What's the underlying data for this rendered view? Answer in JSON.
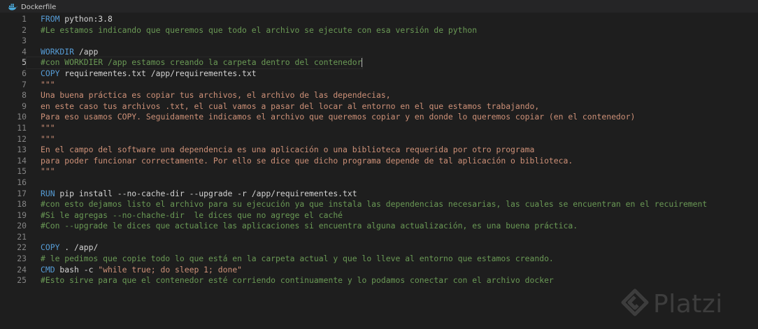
{
  "tab": {
    "filename": "Dockerfile",
    "icon": "docker-icon"
  },
  "colors": {
    "keyword": "#569cd6",
    "comment": "#6a9955",
    "string": "#ce9178",
    "text": "#d4d4d4",
    "line_number": "#858585"
  },
  "editor": {
    "cursor_line": 5,
    "lines": [
      {
        "n": "1",
        "tokens": [
          {
            "t": "kw",
            "v": "FROM"
          },
          {
            "t": "tx",
            "v": " python:3.8"
          }
        ]
      },
      {
        "n": "2",
        "tokens": [
          {
            "t": "cm",
            "v": "#Le estamos indicando que queremos que todo el archivo se ejecute con esa versión de python"
          }
        ]
      },
      {
        "n": "3",
        "tokens": []
      },
      {
        "n": "4",
        "tokens": [
          {
            "t": "kw",
            "v": "WORKDIR"
          },
          {
            "t": "tx",
            "v": " /app"
          }
        ]
      },
      {
        "n": "5",
        "tokens": [
          {
            "t": "cm",
            "v": "#con WORKDIER /app estamos creando la carpeta dentro del contenedor"
          }
        ]
      },
      {
        "n": "6",
        "tokens": [
          {
            "t": "kw",
            "v": "COPY"
          },
          {
            "t": "tx",
            "v": " requirementes.txt /app/requirementes.txt"
          }
        ]
      },
      {
        "n": "7",
        "tokens": [
          {
            "t": "st",
            "v": "\"\"\""
          }
        ]
      },
      {
        "n": "8",
        "tokens": [
          {
            "t": "st",
            "v": "Una buena práctica es copiar tus archivos, el archivo de las dependecias,"
          }
        ]
      },
      {
        "n": "9",
        "tokens": [
          {
            "t": "st",
            "v": "en este caso tus archivos .txt, el cual vamos a pasar del locar al entorno en el que estamos trabajando,"
          }
        ]
      },
      {
        "n": "10",
        "tokens": [
          {
            "t": "st",
            "v": "Para eso usamos COPY. Seguidamente indicamos el archivo que queremos copiar y en donde lo queremos copiar (en el contenedor)"
          }
        ]
      },
      {
        "n": "11",
        "tokens": [
          {
            "t": "st",
            "v": "\"\"\""
          }
        ]
      },
      {
        "n": "12",
        "tokens": [
          {
            "t": "st",
            "v": "\"\"\""
          }
        ]
      },
      {
        "n": "13",
        "tokens": [
          {
            "t": "st",
            "v": "En el campo del software una dependencia es una aplicación o una biblioteca requerida por otro programa"
          }
        ]
      },
      {
        "n": "14",
        "tokens": [
          {
            "t": "st",
            "v": "para poder funcionar correctamente. Por ello se dice que dicho programa depende de tal aplicación o biblioteca."
          }
        ]
      },
      {
        "n": "15",
        "tokens": [
          {
            "t": "st",
            "v": "\"\"\""
          }
        ]
      },
      {
        "n": "16",
        "tokens": []
      },
      {
        "n": "17",
        "tokens": [
          {
            "t": "kw",
            "v": "RUN"
          },
          {
            "t": "tx",
            "v": " pip install --no-cache-dir --upgrade -r /app/requirementes.txt"
          }
        ]
      },
      {
        "n": "18",
        "tokens": [
          {
            "t": "cm",
            "v": "#con esto dejamos listo el archivo para su ejecución ya que instala las dependencias necesarias, las cuales se encuentran en el recuirement"
          }
        ]
      },
      {
        "n": "19",
        "tokens": [
          {
            "t": "cm",
            "v": "#Si le agregas --no-chache-dir  le dices que no agrege el caché"
          }
        ]
      },
      {
        "n": "20",
        "tokens": [
          {
            "t": "cm",
            "v": "#Con --upgrade le dices que actualice las aplicaciones si encuentra alguna actualización, es una buena práctica."
          }
        ]
      },
      {
        "n": "21",
        "tokens": []
      },
      {
        "n": "22",
        "tokens": [
          {
            "t": "kw",
            "v": "COPY"
          },
          {
            "t": "tx",
            "v": " . /app/"
          }
        ]
      },
      {
        "n": "23",
        "tokens": [
          {
            "t": "cm",
            "v": "# le pedimos que copie todo lo que está en la carpeta actual y que lo lleve al entorno que estamos creando."
          }
        ]
      },
      {
        "n": "24",
        "tokens": [
          {
            "t": "kw",
            "v": "CMD"
          },
          {
            "t": "tx",
            "v": " bash -c "
          },
          {
            "t": "st",
            "v": "\"while true; do sleep 1; done\""
          }
        ]
      },
      {
        "n": "25",
        "tokens": [
          {
            "t": "cm",
            "v": "#Esto sirve para que el contenedor esté corriendo continuamente y lo podamos conectar con el archivo docker"
          }
        ]
      }
    ]
  },
  "watermark": {
    "text": "Platzi",
    "icon": "platzi-logo-icon"
  }
}
